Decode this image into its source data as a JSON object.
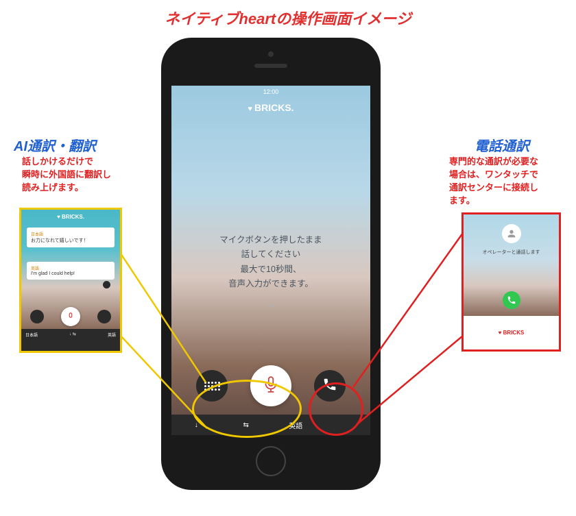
{
  "page_title": "ネイティブheartの操作画面イメージ",
  "phone": {
    "status_time": "12:00",
    "brand": "BRICKS.",
    "instruction_lines": [
      "マイクボタンを押したまま",
      "話してください",
      "最大で10秒間、",
      "音声入力ができます。"
    ],
    "chevron": "⌄",
    "bottom_bar": {
      "left_arrow": "↓",
      "swap": "⇆",
      "lang": "英語",
      "right_arrow": ""
    },
    "buttons": {
      "keyboard": "keyboard-icon",
      "mic": "mic-icon",
      "call": "call-icon"
    }
  },
  "left": {
    "title": "AI通訳・翻訳",
    "desc_lines": [
      "話しかけるだけで",
      "瞬時に外国語に翻訳し",
      "読み上げます。"
    ],
    "shot": {
      "brand": "♥ BRICKS.",
      "bubble1_label": "日本語",
      "bubble1_text": "お力になれて嬉しいです！",
      "bubble2_label": "英語",
      "bubble2_text": "I'm glad I could help!",
      "bottom_left": "日本語",
      "bottom_right": "英語"
    }
  },
  "right": {
    "title": "電話通訳",
    "desc_lines": [
      "専門的な通訳が必要な",
      "場合は、ワンタッチで",
      "通訳センターに接続し",
      "ます。"
    ],
    "shot": {
      "text": "オペレーターと通話します",
      "footer": "♥ BRICKS"
    }
  }
}
